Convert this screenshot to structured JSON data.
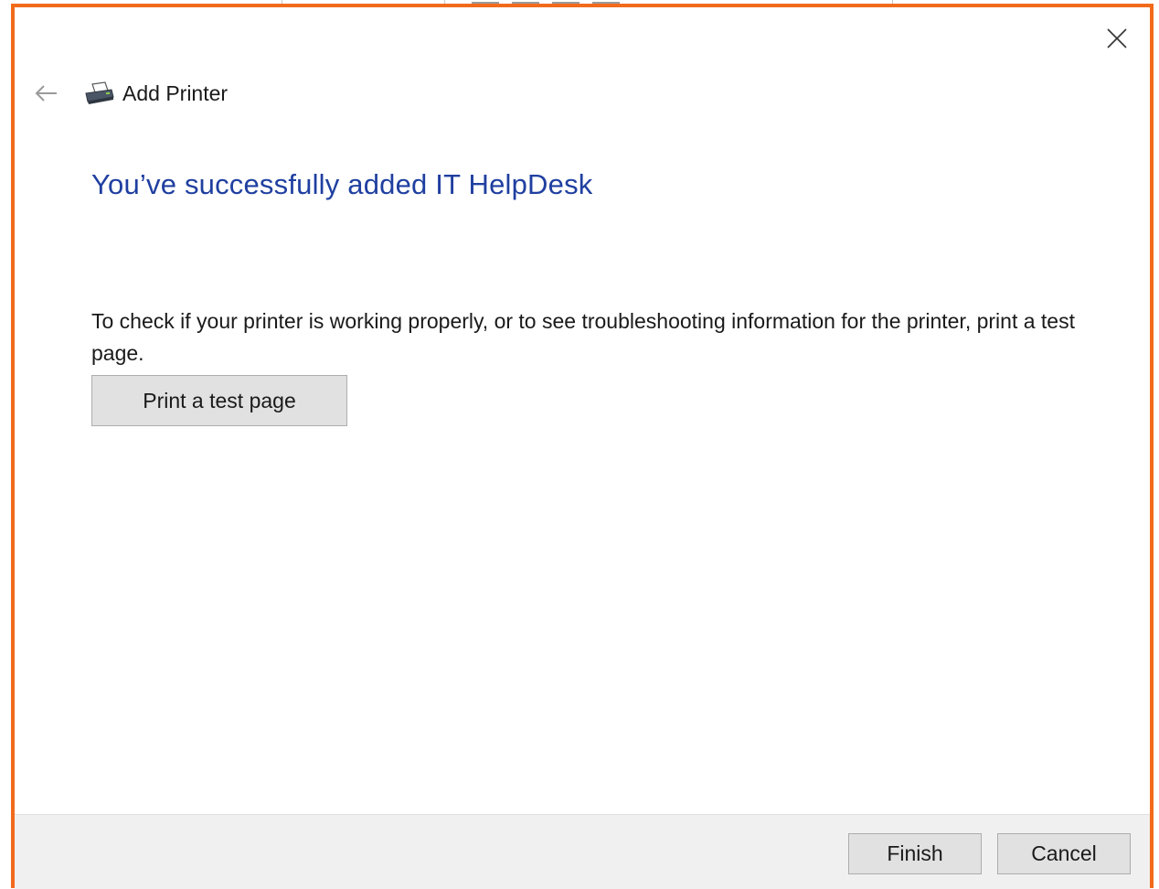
{
  "dialog": {
    "title": "Add Printer",
    "headline": "You’ve successfully added IT HelpDesk",
    "description": "To check if your printer is working properly, or to see troubleshooting information for the printer, print a test page.",
    "test_page_button": "Print a test page",
    "finish_button": "Finish",
    "cancel_button": "Cancel"
  },
  "icons": {
    "close": "close-icon",
    "back": "back-arrow-icon",
    "printer": "printer-icon"
  },
  "colors": {
    "accent_border": "#f26a1b",
    "headline": "#1f3fa0",
    "footer_bg": "#f0f0f0"
  }
}
